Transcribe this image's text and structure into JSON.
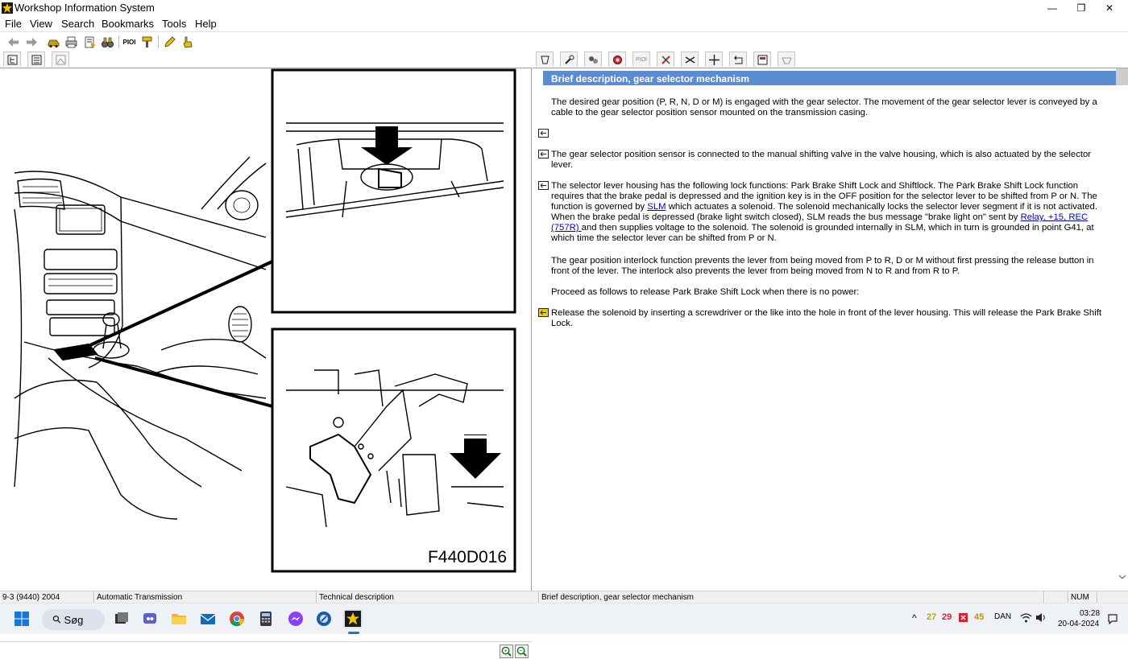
{
  "window": {
    "title": "Workshop Information System",
    "minimize_glyph": "—",
    "maximize_glyph": "❐",
    "close_glyph": "✕"
  },
  "menu": {
    "items": [
      "File",
      "View",
      "Search",
      "Bookmarks",
      "Tools",
      "Help"
    ]
  },
  "toolbar": {
    "buttons": [
      "back-arrow-icon",
      "forward-arrow-icon",
      "car-icon",
      "printer-icon",
      "add-bookmark-icon",
      "binoculars-icon",
      "pioi-icon",
      "yellow-tool-icon",
      "pencil-icon",
      "pointer-hand-icon"
    ],
    "pioi_label": "PIOI"
  },
  "left_tabs": [
    "tree-view-icon",
    "list-view-icon",
    "image-view-icon"
  ],
  "right_tabs": {
    "icons": [
      "gearbox-icon",
      "wrench-icon",
      "components-icon",
      "diagnostics-icon",
      "pioi-icon",
      "tools-icon",
      "adjustment-icon",
      "position-icon",
      "history-icon",
      "bulletin-icon",
      "part-icon"
    ],
    "pioi_label": "PIOI"
  },
  "illustration": {
    "code": "F440D016"
  },
  "zoom": {
    "zoom_in": "+",
    "zoom_out": "−"
  },
  "document": {
    "header": "Brief description, gear selector mechanism",
    "p1": "The desired gear position (P, R, N, D or M) is engaged with the gear selector. The movement of the gear selector lever is conveyed by a cable to the gear selector position sensor mounted on the transmission casing.",
    "p2": "The gear selector position sensor is connected to the manual shifting valve in the valve housing, which is also actuated by the selector lever.",
    "p3_a": "The selector lever housing has the following lock functions: Park Brake Shift Lock and Shiftlock. The Park Brake Shift Lock function requires that the brake pedal is depressed and the ignition key is in the OFF position for the selector lever to be shifted from P or N. The function is governed by ",
    "p3_link1": "SLM",
    "p3_b": " which actuates a solenoid. The solenoid mechanically locks the selector lever segment if it is not activated. When the brake pedal is depressed (brake light switch closed), SLM reads the bus message \"brake light on\" sent by ",
    "p3_link2": "Relay, +15, REC (757R) ",
    "p3_c": "and then supplies voltage to the solenoid. The solenoid is grounded internally in SLM, which in turn is grounded in point G41, at which time the selector lever can be shifted from P or N.",
    "p4": "The gear position interlock function prevents the lever from being moved from P to R, D or M without first pressing the release button in front of the lever. The interlock also prevents the lever from being moved from N to R and from R to P.",
    "p5": "Proceed as follows to release Park Brake Shift Lock when there is no power:",
    "p6": "Release the solenoid by inserting a screwdriver or the like into the hole in front of the lever housing. This will release the Park Brake Shift Lock."
  },
  "statusbar": {
    "model": "9-3 (9440) 2004",
    "system": "Automatic Transmission",
    "doc_type": "Technical description",
    "doc_title": "Brief description, gear selector mechanism",
    "num": "NUM"
  },
  "taskbar": {
    "search_label": "Søg",
    "search_glyph": "⚲",
    "tray_chevron": "^",
    "tray_n1": "27",
    "tray_n2": "29",
    "tray_n3": "45",
    "lang": "DAN",
    "time": "03:28",
    "date": "20-04-2024",
    "colors": {
      "n1": "#c8a000",
      "n2": "#d4202a",
      "n3": "#d08a00"
    }
  }
}
